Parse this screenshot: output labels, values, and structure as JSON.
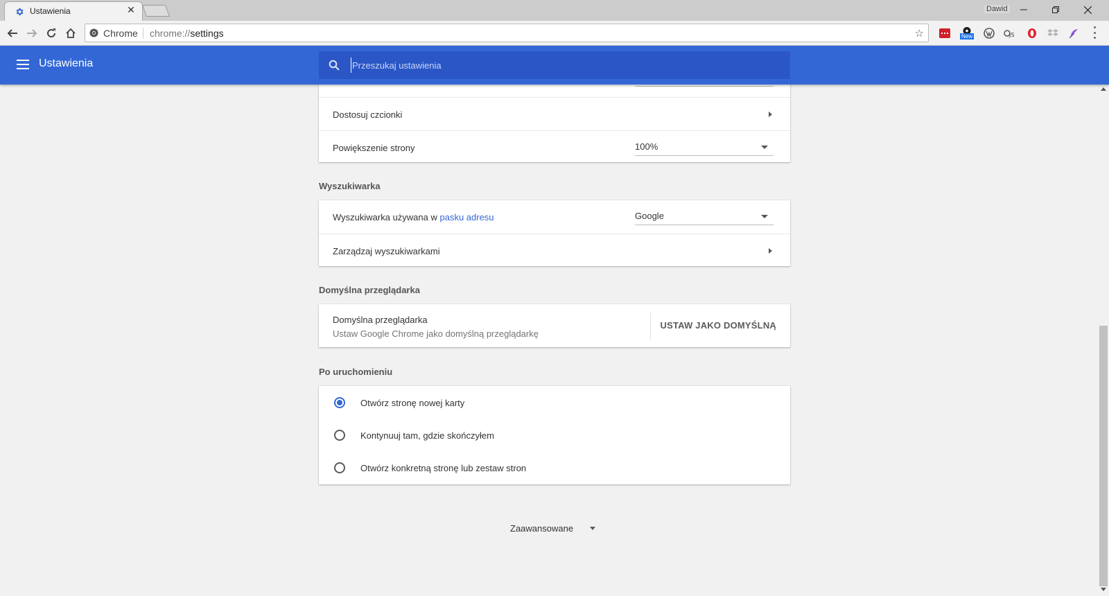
{
  "browser": {
    "tab_title": "Ustawienia",
    "tab_close": "✕",
    "profile_name": "Dawid",
    "omnibox": {
      "site_label": "Chrome",
      "url_scheme": "chrome://",
      "url_path": "settings"
    },
    "extensions": [
      "ext-red-icon",
      "ext-new-icon",
      "ext-wordpress-icon",
      "ext-js-icon",
      "ext-opera-icon",
      "ext-dropbox-icon",
      "ext-feather-icon"
    ],
    "extension_badge": "New",
    "accent": "#3367d6"
  },
  "header": {
    "title": "Ustawienia",
    "search_placeholder": "Przeszukaj ustawienia"
  },
  "appearance": {
    "fonts_label": "Dostosuj czcionki",
    "zoom_label": "Powiększenie strony",
    "zoom_value": "100%"
  },
  "search_engine": {
    "section_title": "Wyszukiwarka",
    "engine_label_prefix": "Wyszukiwarka używana w ",
    "engine_label_link": "pasku adresu",
    "engine_value": "Google",
    "manage_label": "Zarządzaj wyszukiwarkami"
  },
  "default_browser": {
    "section_title": "Domyślna przeglądarka",
    "primary": "Domyślna przeglądarka",
    "secondary": "Ustaw Google Chrome jako domyślną przeglądarkę",
    "button": "USTAW JAKO DOMYŚLNĄ"
  },
  "startup": {
    "section_title": "Po uruchomieniu",
    "options": [
      {
        "label": "Otwórz stronę nowej karty",
        "selected": true
      },
      {
        "label": "Kontynuuj tam, gdzie skończyłem",
        "selected": false
      },
      {
        "label": "Otwórz konkretną stronę lub zestaw stron",
        "selected": false
      }
    ]
  },
  "advanced_label": "Zaawansowane"
}
